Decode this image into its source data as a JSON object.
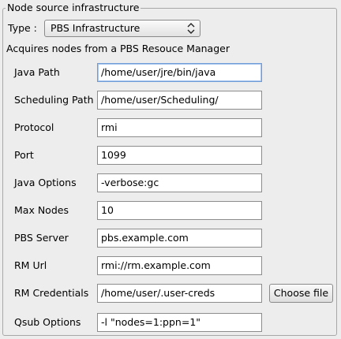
{
  "group": {
    "title": "Node source infrastructure"
  },
  "type": {
    "label": "Type :",
    "selected": "PBS Infrastructure"
  },
  "description": "Acquires nodes from a PBS Resouce Manager",
  "fields": [
    {
      "label": "Java Path",
      "value": "/home/user/jre/bin/java"
    },
    {
      "label": "Scheduling Path",
      "value": "/home/user/Scheduling/"
    },
    {
      "label": "Protocol",
      "value": "rmi"
    },
    {
      "label": "Port",
      "value": "1099"
    },
    {
      "label": "Java Options",
      "value": "-verbose:gc"
    },
    {
      "label": "Max Nodes",
      "value": "10"
    },
    {
      "label": "PBS Server",
      "value": "pbs.example.com"
    },
    {
      "label": "RM Url",
      "value": "rmi://rm.example.com"
    },
    {
      "label": "RM Credentials",
      "value": "/home/user/.user-creds"
    },
    {
      "label": "Qsub Options",
      "value": "-l \"nodes=1:ppn=1\""
    }
  ],
  "choose_file_label": "Choose file",
  "icons": {
    "select_arrow": "up-down-arrows-icon"
  }
}
